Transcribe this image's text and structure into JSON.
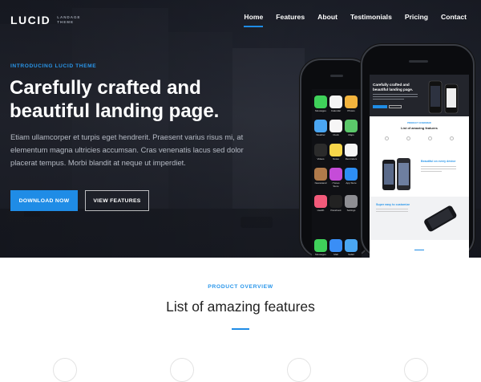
{
  "brand": {
    "name": "LUCID",
    "subtitle_line1": "LANDAGE",
    "subtitle_line2": "THEME"
  },
  "nav": {
    "items": [
      "Home",
      "Features",
      "About",
      "Testimonials",
      "Pricing",
      "Contact"
    ],
    "active": "Home"
  },
  "hero": {
    "eyebrow": "INTRODUCING LUCID THEME",
    "headline": "Carefully crafted and beautiful landing page.",
    "lead": "Etiam ullamcorper et turpis eget hendrerit. Praesent varius risus mi, at elementum magna ultricies accumsan. Cras venenatis lacus sed dolor placerat tempus. Morbi blandit at neque ut imperdiet.",
    "primary_button": "DOWNLOAD NOW",
    "secondary_button": "VIEW FEATURES"
  },
  "phone_left": {
    "apps": [
      "Messages",
      "Calendar",
      "Photos",
      "Weather",
      "Clock",
      "Maps",
      "Videos",
      "Notes",
      "Reminders",
      "Newsstand",
      "iTunes Store",
      "App Store",
      "Health",
      "Passbook",
      "Settings"
    ],
    "dock": [
      "Messages",
      "Mail",
      "Safari"
    ]
  },
  "phone_right": {
    "mini_title": "Carefully crafted and beautiful landing page.",
    "mini_section_label": "PRODUCT OVERVIEW",
    "mini_section_title": "List of amazing features",
    "mini_section2_title": "Beautiful on every device",
    "mini_section3_title": "Super easy to customize"
  },
  "overview": {
    "label": "PRODUCT OVERVIEW",
    "title": "List of amazing features"
  },
  "colors": {
    "accent": "#1f8ce6",
    "hero_dark": "#1d1f27",
    "heading": "#222222"
  }
}
